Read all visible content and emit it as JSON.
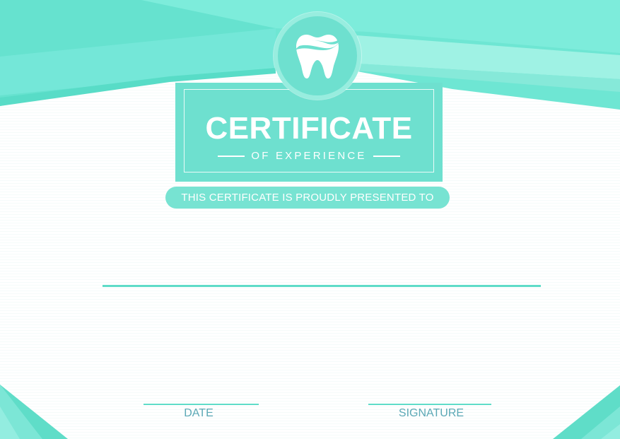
{
  "certificate": {
    "title": "CERTIFICATE",
    "subtitle": "OF EXPERIENCE",
    "presented_to": "THIS CERTIFICATE IS PROUDLY PRESENTED TO",
    "recipient_name": "",
    "date_label": "DATE",
    "signature_label": "SIGNATURE",
    "emblem_icon": "tooth-icon"
  },
  "colors": {
    "accent": "#6ee0cf",
    "accent_light": "#98eddf",
    "accent_dark": "#5fdcc8",
    "label_text": "#5ba8b5",
    "background": "#ffffff"
  }
}
